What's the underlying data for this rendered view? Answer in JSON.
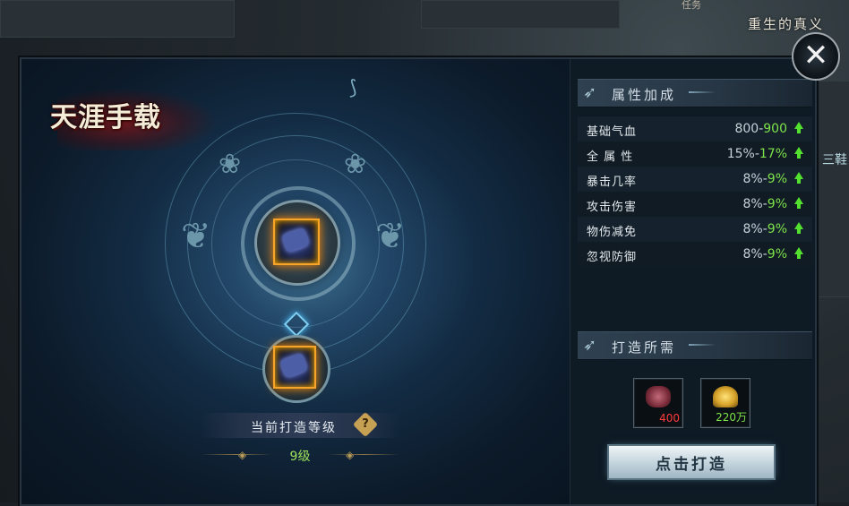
{
  "world": {
    "map_label": "重生的真义",
    "top_sublabel": "任务",
    "side_label": "三鞋"
  },
  "panel": {
    "title": "天涯手载",
    "current_level_label": "当前打造等级",
    "current_level_value": "9级",
    "help_icon_glyph": "?"
  },
  "attributes": {
    "header": "属性加成",
    "rows": [
      {
        "name": "基础气血",
        "old": "800-",
        "new": "900"
      },
      {
        "name": "全 属 性",
        "old": "15%-",
        "new": "17%"
      },
      {
        "name": "暴击几率",
        "old": "8%-",
        "new": "9%"
      },
      {
        "name": "攻击伤害",
        "old": "8%-",
        "new": "9%"
      },
      {
        "name": "物伤减免",
        "old": "8%-",
        "new": "9%"
      },
      {
        "name": "忽视防御",
        "old": "8%-",
        "new": "9%"
      }
    ]
  },
  "requirements": {
    "header": "打造所需",
    "materials": [
      {
        "icon": "ore-icon",
        "qty": "400",
        "qty_color": "#ff3b3b"
      },
      {
        "icon": "gold-ingot-icon",
        "qty": "220万",
        "qty_color": "#7ee24a"
      }
    ],
    "plus": "+",
    "forge_button": "点击打造"
  },
  "close_icon": "✕"
}
